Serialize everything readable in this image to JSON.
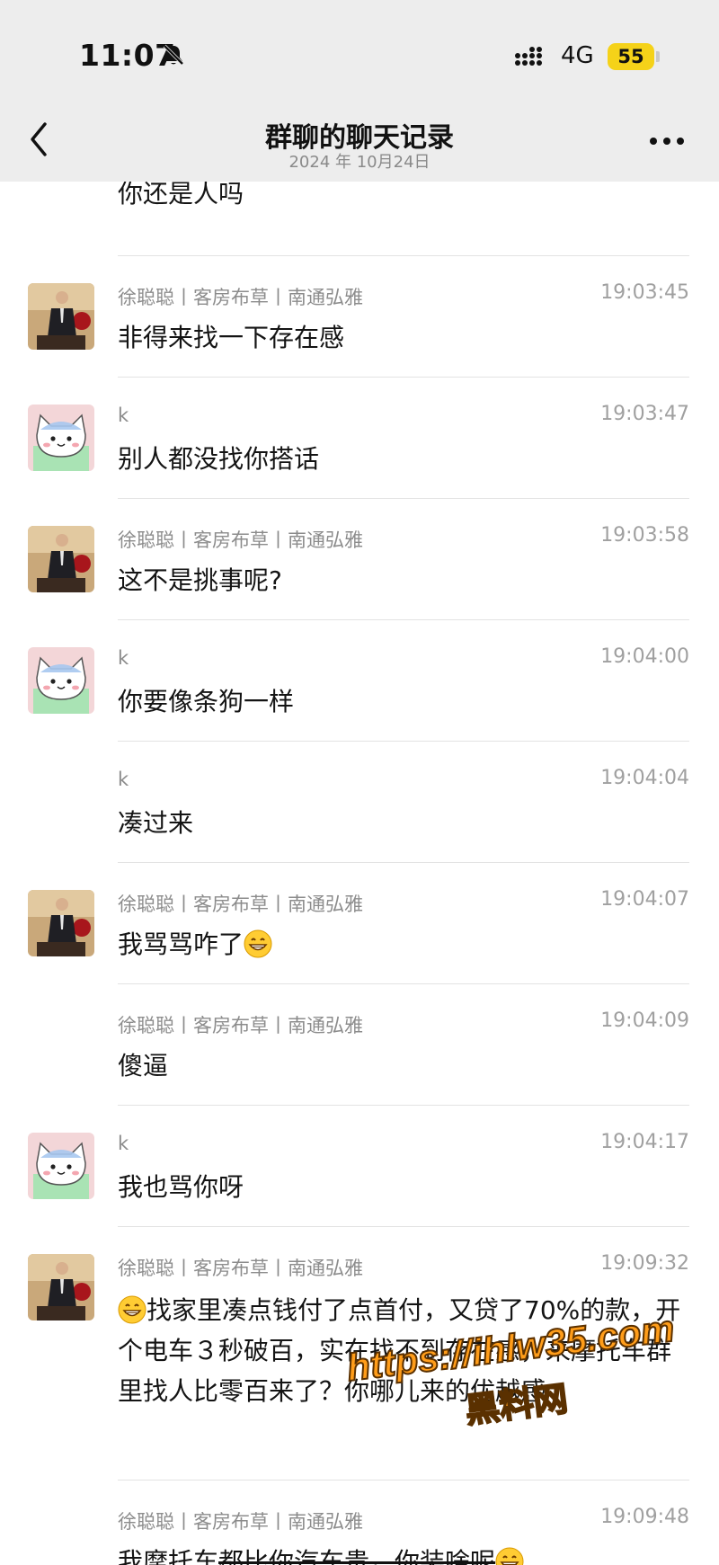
{
  "status_bar": {
    "time": "11:07",
    "network": "4G",
    "battery": "55"
  },
  "nav": {
    "title": "群聊的聊天记录",
    "date": "2024 年 10月24日"
  },
  "messages": [
    {
      "sender": "",
      "time": "",
      "text": "你还是人吗",
      "avatar": "cat"
    },
    {
      "sender": "徐聪聪丨客房布草丨南通弘雅",
      "time": "19:03:45",
      "text": "非得来找一下存在感",
      "avatar": "man"
    },
    {
      "sender": "k",
      "time": "19:03:47",
      "text": "别人都没找你搭话",
      "avatar": "cat"
    },
    {
      "sender": "徐聪聪丨客房布草丨南通弘雅",
      "time": "19:03:58",
      "text": "这不是挑事呢?",
      "avatar": "man"
    },
    {
      "sender": "k",
      "time": "19:04:00",
      "text": "你要像条狗一样",
      "avatar": "cat"
    },
    {
      "sender": "k",
      "time": "19:04:04",
      "text": "凑过来",
      "avatar": ""
    },
    {
      "sender": "徐聪聪丨客房布草丨南通弘雅",
      "time": "19:04:07",
      "text": "我骂骂咋了",
      "avatar": "man",
      "emoji_after": "grin"
    },
    {
      "sender": "徐聪聪丨客房布草丨南通弘雅",
      "time": "19:04:09",
      "text": "傻逼",
      "avatar": ""
    },
    {
      "sender": "k",
      "time": "19:04:17",
      "text": "我也骂你呀",
      "avatar": "cat"
    },
    {
      "sender": "徐聪聪丨客房布草丨南通弘雅",
      "time": "19:09:32",
      "text": "找家里凑点钱付了点首付，又贷了70%的款，开个电车３秒破百，实在找不到存在感，来摩托车群里找人比零百来了？你哪儿来的优越感",
      "avatar": "man",
      "emoji_before": "grin"
    },
    {
      "sender": "徐聪聪丨客房布草丨南通弘雅",
      "time": "19:09:48",
      "text_a": "我摩托车",
      "text_b": "都比你汽车贵，你装啥呢",
      "avatar": "",
      "emoji_after": "grin"
    }
  ],
  "watermark": {
    "url": "https://ihlw35.com",
    "label": "黑料网"
  },
  "icons": {
    "mute": "bell-slash-icon",
    "signal": "signal-bars-icon",
    "back": "chevron-left-icon",
    "more": "more-dots-icon",
    "emoji": "grinning-face-emoji"
  },
  "colors": {
    "topbar": "#ededed",
    "battery": "#f5d219",
    "watermark": "#ff9d1a"
  }
}
